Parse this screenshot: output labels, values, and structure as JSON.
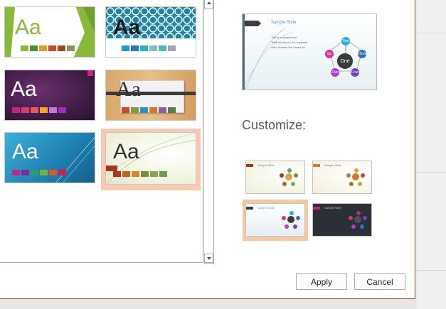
{
  "themes": [
    {
      "id": "theme-1",
      "sample": "Aa",
      "swatches": [
        "#8ab83a",
        "#4e8a3c",
        "#d9a022",
        "#d24726",
        "#a1482b",
        "#8e8e52"
      ],
      "selected": false
    },
    {
      "id": "theme-2",
      "sample": "Aa",
      "swatches": [
        "#1d9ac8",
        "#2e75b6",
        "#27b2c9",
        "#7fbfbf",
        "#4ebcad",
        "#a5a5a5"
      ],
      "selected": false
    },
    {
      "id": "theme-3",
      "sample": "Aa",
      "swatches": [
        "#c42382",
        "#d83b7a",
        "#e8556a",
        "#f5a623",
        "#c07bd6",
        "#a02bbf"
      ],
      "selected": false
    },
    {
      "id": "theme-4",
      "sample": "Aa",
      "swatches": [
        "#c94b2c",
        "#7e9c3b",
        "#2e91b3",
        "#d67924",
        "#8a5fa0",
        "#527e4a"
      ],
      "selected": false
    },
    {
      "id": "theme-5",
      "sample": "Aa",
      "swatches": [
        "#c7248a",
        "#7b2aa1",
        "#2e9e6c",
        "#7dae3a",
        "#d95b27",
        "#d01d4b"
      ],
      "selected": false
    },
    {
      "id": "theme-6",
      "sample": "Aa",
      "swatches": [
        "#a5361f",
        "#c65e1f",
        "#d08a2c",
        "#7e8b3c",
        "#8aa357",
        "#6e9b5a"
      ],
      "selected": true
    }
  ],
  "preview": {
    "title": "Sample Slide",
    "bullets": [
      "This is a sample text",
      "That will need to be localized",
      "Also, localize the Smart Art"
    ],
    "center_label": "One",
    "nodes": [
      "Two",
      "Three",
      "Four",
      "Five",
      "Six"
    ]
  },
  "customize": {
    "label": "Customize:",
    "variants": [
      {
        "id": "variant-1",
        "title": "Sample Slide",
        "dark": false,
        "selected": false
      },
      {
        "id": "variant-2",
        "title": "Sample Slide",
        "dark": false,
        "selected": false
      },
      {
        "id": "variant-3",
        "title": "Sample Slide",
        "dark": false,
        "selected": true
      },
      {
        "id": "variant-4",
        "title": "Sample Slide",
        "dark": true,
        "selected": false
      }
    ]
  },
  "buttons": {
    "apply": "Apply",
    "cancel": "Cancel"
  },
  "colors": {
    "accent": "#d24726",
    "selection": "#f9c8b1"
  }
}
